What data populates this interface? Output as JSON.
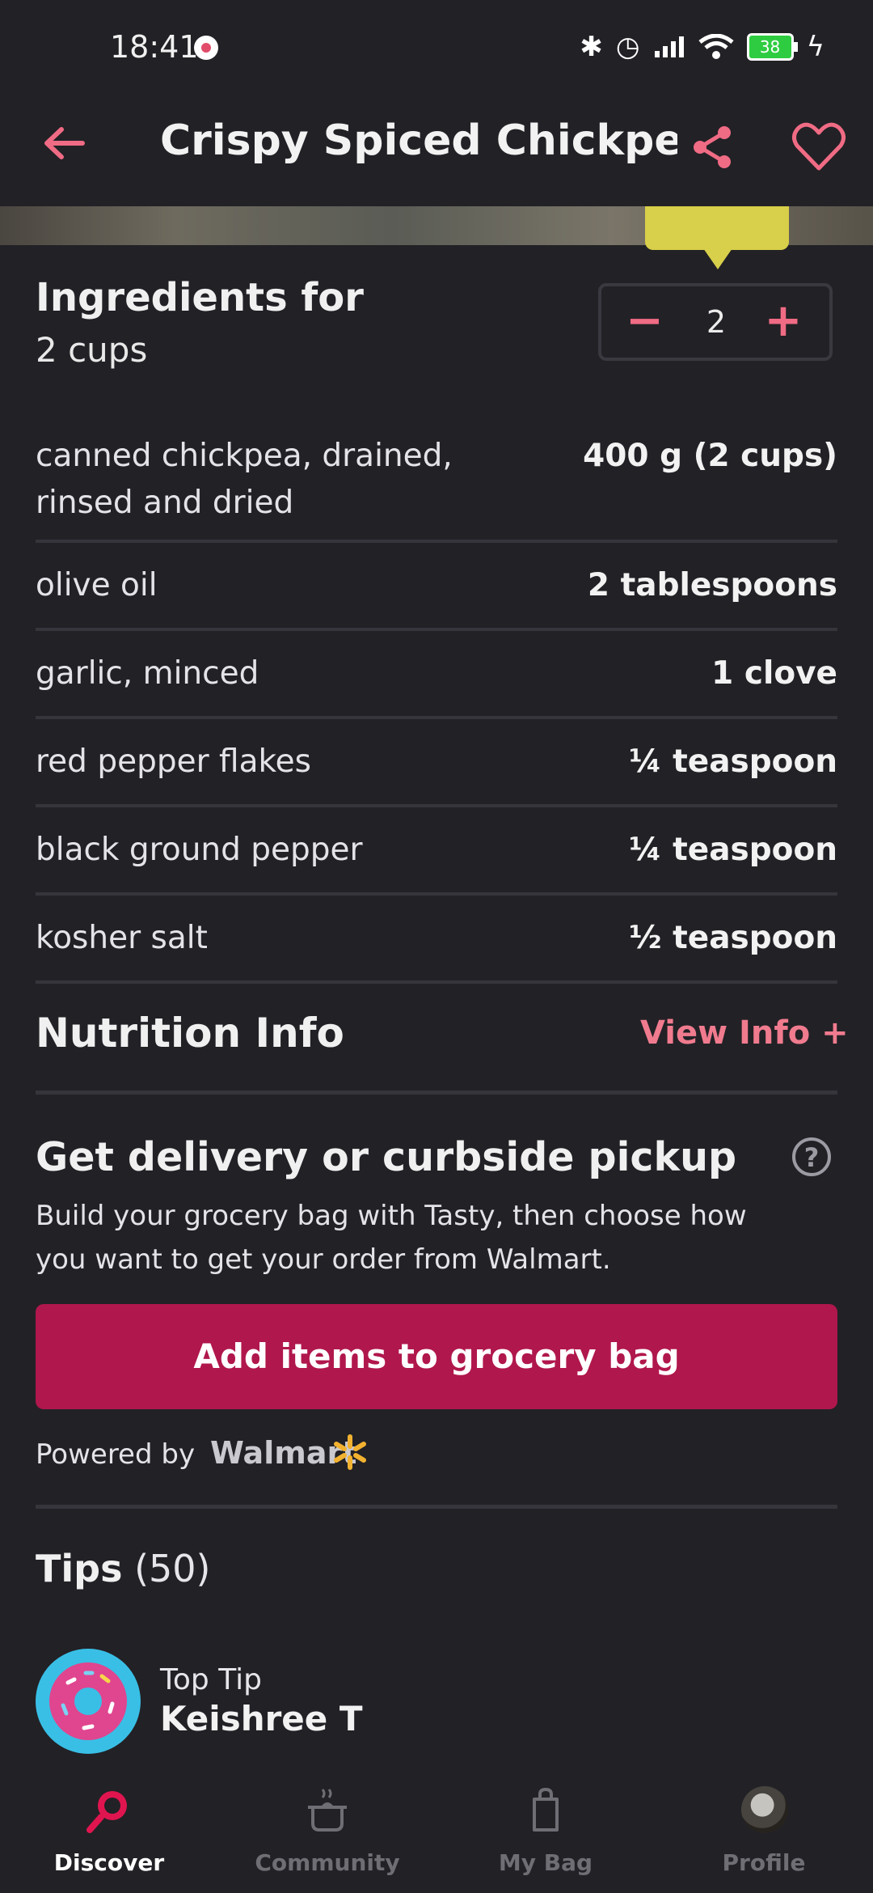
{
  "status_bar": {
    "time": "18:41",
    "battery": "38"
  },
  "header": {
    "title": "Crispy Spiced Chickpe..."
  },
  "ingredients": {
    "title": "Ingredients for",
    "yield": "2 cups",
    "servings_value": "2",
    "minus_symbol": "−",
    "plus_symbol": "+",
    "items": [
      {
        "name": "canned chickpea, drained, rinsed and dried",
        "amount": "400 g (2 cups)"
      },
      {
        "name": "olive oil",
        "amount": "2 tablespoons"
      },
      {
        "name": "garlic, minced",
        "amount": "1 clove"
      },
      {
        "name": "red pepper flakes",
        "amount": "¼ teaspoon"
      },
      {
        "name": "black ground pepper",
        "amount": "¼ teaspoon"
      },
      {
        "name": "kosher salt",
        "amount": "½ teaspoon"
      }
    ]
  },
  "nutrition": {
    "title": "Nutrition Info",
    "link": "View Info +"
  },
  "delivery": {
    "title": "Get delivery or curbside pickup",
    "help_symbol": "?",
    "body": "Build your grocery bag with Tasty, then choose how you want to get your order from Walmart.",
    "button": "Add items to grocery bag",
    "powered_by": "Powered by",
    "brand": "Walmart"
  },
  "tips": {
    "label": "Tips",
    "count": "(50)"
  },
  "top_tip": {
    "label": "Top Tip",
    "author": "Keishree T"
  },
  "nav": {
    "discover": "Discover",
    "community": "Community",
    "bag": "My Bag",
    "profile": "Profile"
  },
  "colors": {
    "accent": "#f06b84",
    "cta": "#b0174c",
    "background": "#222126",
    "tooltip": "#d8cf4a"
  }
}
